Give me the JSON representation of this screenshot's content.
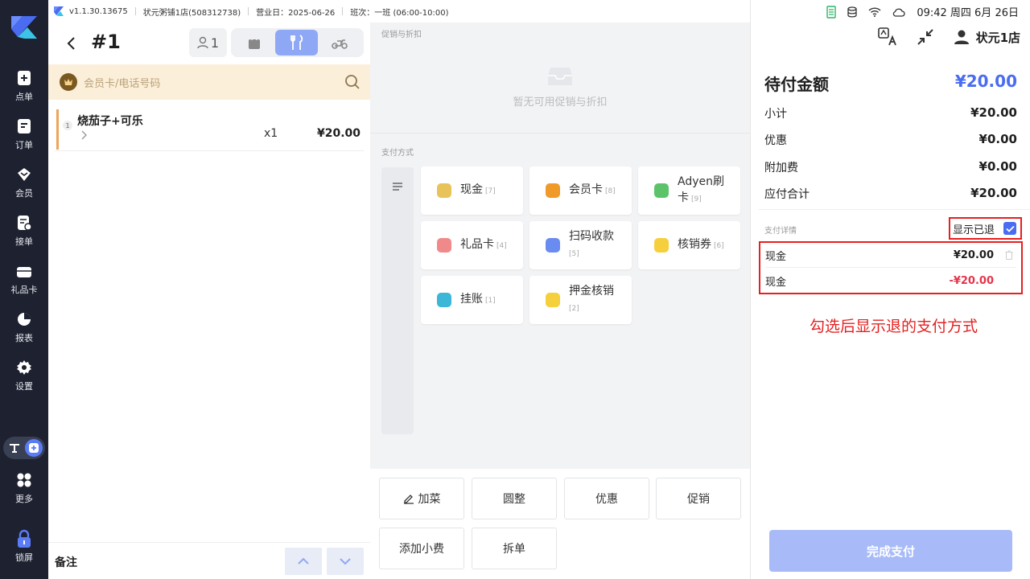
{
  "nav": {
    "items": [
      {
        "label": "点单",
        "icon": "add-order-icon"
      },
      {
        "label": "订单",
        "icon": "orders-icon"
      },
      {
        "label": "会员",
        "icon": "member-icon"
      },
      {
        "label": "接单",
        "icon": "accept-order-icon"
      },
      {
        "label": "礼品卡",
        "icon": "gift-card-icon"
      },
      {
        "label": "报表",
        "icon": "report-icon"
      },
      {
        "label": "设置",
        "icon": "settings-icon"
      },
      {
        "label": "更多",
        "icon": "more-icon"
      },
      {
        "label": "锁屏",
        "icon": "lock-icon"
      }
    ]
  },
  "topbar": {
    "version": "v1.1.30.13675",
    "store": "状元粥铺1店(508312738)",
    "business_day": "营业日：2025-06-26",
    "shift": "班次：一班 (06:00-10:00)"
  },
  "order": {
    "number": "#1",
    "guests": "1",
    "member_placeholder": "会员卡/电话号码",
    "items": [
      {
        "index": "1",
        "name": "烧茄子+可乐",
        "qty": "x1",
        "price": "¥20.00"
      }
    ],
    "remark_label": "备注"
  },
  "promo": {
    "section_label": "促销与折扣",
    "empty_text": "暂无可用促销与折扣"
  },
  "payment": {
    "section_label": "支付方式",
    "methods": [
      {
        "label": "现金",
        "count": "[7]",
        "color": "#e7c35a"
      },
      {
        "label": "会员卡",
        "count": "[8]",
        "color": "#f09a2a"
      },
      {
        "label": "Adyen刷",
        "label2": "卡",
        "count": "[9]",
        "color": "#5cc36a"
      },
      {
        "label": "礼品卡",
        "count": "[4]",
        "color": "#f08a8a"
      },
      {
        "label": "扫码收款",
        "count": "[5]",
        "color": "#6a8cf0"
      },
      {
        "label": "核销券",
        "count": "[6]",
        "color": "#f6cf3c"
      },
      {
        "label": "挂账",
        "count": "[1]",
        "color": "#3cb7d8"
      },
      {
        "label": "押金核销",
        "count": "[2]",
        "color": "#f6cf3c"
      }
    ]
  },
  "actions": {
    "add_dish": "加菜",
    "round": "圆整",
    "discount": "优惠",
    "promotion": "促销",
    "add_tip": "添加小费",
    "split": "拆单"
  },
  "status": {
    "time": "09:42 周四 6月 26日"
  },
  "right": {
    "store_name": "状元1店",
    "due_label": "待付金额",
    "due_amount": "¥20.00",
    "rows": [
      {
        "label": "小计",
        "value": "¥20.00"
      },
      {
        "label": "优惠",
        "value": "¥0.00"
      },
      {
        "label": "附加费",
        "value": "¥0.00"
      },
      {
        "label": "应付合计",
        "value": "¥20.00"
      }
    ],
    "detail_label": "支付详情",
    "show_refunded_label": "显示已退",
    "show_refunded_checked": true,
    "payments": [
      {
        "method": "现金",
        "amount": "¥20.00",
        "color": "#111111"
      },
      {
        "method": "现金",
        "amount": "-¥20.00",
        "color": "#e5334a"
      }
    ],
    "annotation": "勾选后显示退的支付方式",
    "finish_label": "完成支付"
  }
}
